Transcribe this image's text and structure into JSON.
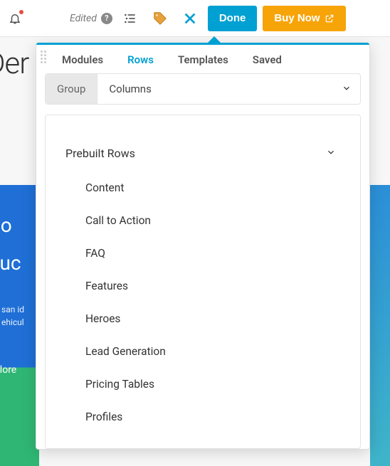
{
  "topbar": {
    "edited_label": "Edited",
    "done_label": "Done",
    "buy_label": "Buy Now"
  },
  "background": {
    "title_fragment": "Der",
    "hero_line1": "bo",
    "hero_line2": "suc",
    "hero_small": "san id\nehicul",
    "explore": "xplore"
  },
  "panel": {
    "tabs": [
      {
        "label": "Modules",
        "active": false
      },
      {
        "label": "Rows",
        "active": true
      },
      {
        "label": "Templates",
        "active": false
      },
      {
        "label": "Saved",
        "active": false
      }
    ],
    "subbar": {
      "group_label": "Group",
      "columns_label": "Columns"
    },
    "dropdown": {
      "header": "Prebuilt Rows",
      "items": [
        "Content",
        "Call to Action",
        "FAQ",
        "Features",
        "Heroes",
        "Lead Generation",
        "Pricing Tables",
        "Profiles"
      ]
    }
  }
}
